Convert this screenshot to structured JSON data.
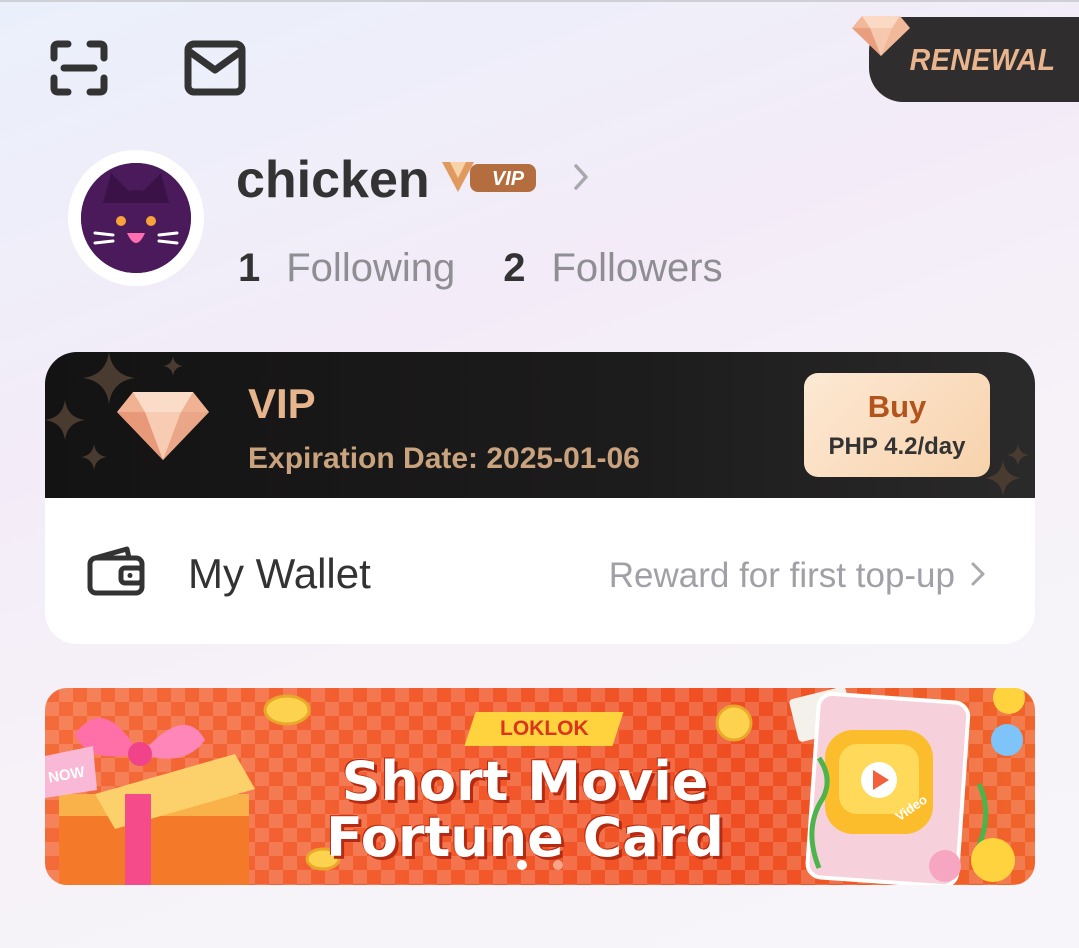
{
  "header": {
    "scan_icon": "scan-icon",
    "mail_icon": "mail-icon",
    "renewal_label": "RENEWAL"
  },
  "profile": {
    "username": "chicken",
    "vip_badge": "VIP",
    "following_count": "1",
    "following_label": "Following",
    "followers_count": "2",
    "followers_label": "Followers"
  },
  "vip_card": {
    "title": "VIP",
    "expiration": "Expiration Date: 2025-01-06",
    "buy_label": "Buy",
    "price": "PHP 4.2/day"
  },
  "wallet": {
    "label": "My Wallet",
    "hint": "Reward for first top-up"
  },
  "banner": {
    "logo": "LOKLOK",
    "title_line1": "Short Movie",
    "title_line2": "Fortune Card",
    "tag": "NOW",
    "video_tag": "Video",
    "page_count": 2,
    "active_page": 1
  },
  "colors": {
    "accent_gold": "#e6b58e",
    "buy_text": "#b2541c",
    "banner_orange": "#f25a2c"
  }
}
